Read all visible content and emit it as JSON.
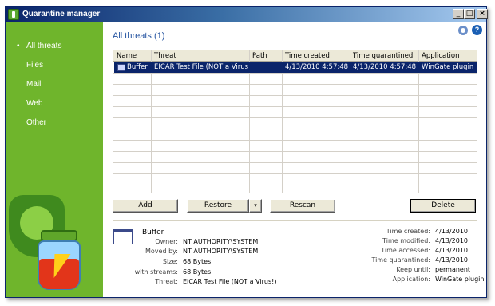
{
  "window": {
    "title": "Quarantine manager",
    "min": "_",
    "max": "□",
    "close": "×"
  },
  "sidebar": {
    "items": [
      {
        "label": "All threats",
        "active": true
      },
      {
        "label": "Files"
      },
      {
        "label": "Mail"
      },
      {
        "label": "Web"
      },
      {
        "label": "Other"
      }
    ]
  },
  "main": {
    "heading": "All threats (1)",
    "help": "?",
    "table": {
      "headers": [
        "Name",
        "Threat",
        "Path",
        "Time created",
        "Time quarantined",
        "Application"
      ],
      "rows": [
        [
          "Buffer",
          "EICAR Test File (NOT a Virus!)",
          "",
          "4/13/2010 4:57:48",
          "4/13/2010 4:57:48",
          "WinGate plugin"
        ]
      ]
    },
    "buttons": {
      "add": "Add",
      "restore": "Restore",
      "restore_arrow": "▾",
      "rescan": "Rescan",
      "delete": "Delete"
    }
  },
  "details": {
    "name": "Buffer",
    "left": [
      {
        "label": "Owner:",
        "value": "NT AUTHORITY\\SYSTEM"
      },
      {
        "label": "Moved by:",
        "value": "NT AUTHORITY\\SYSTEM"
      },
      {
        "label": "Size:",
        "value": "68 Bytes"
      },
      {
        "label": "with streams:",
        "value": "68 Bytes"
      },
      {
        "label": "Threat:",
        "value": "EICAR Test File (NOT a Virus!)"
      }
    ],
    "right": [
      {
        "label": "Time created:",
        "value": "4/13/2010"
      },
      {
        "label": "Time modified:",
        "value": "4/13/2010"
      },
      {
        "label": "Time accessed:",
        "value": "4/13/2010"
      },
      {
        "label": "Time quarantined:",
        "value": "4/13/2010"
      },
      {
        "label": "Keep until:",
        "value": "permanent"
      },
      {
        "label": "Application:",
        "value": "WinGate plugin"
      }
    ]
  }
}
